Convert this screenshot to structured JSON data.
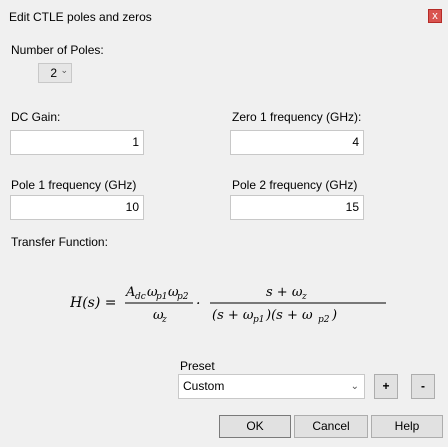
{
  "window": {
    "title": "Edit CTLE poles and zeros",
    "close_label": "x"
  },
  "poles": {
    "label": "Number of Poles:",
    "value": "2"
  },
  "dc_gain": {
    "label": "DC Gain:",
    "value": "1"
  },
  "zero1": {
    "label": "Zero 1 frequency (GHz):",
    "value": "4"
  },
  "pole1": {
    "label": "Pole 1 frequency (GHz)",
    "value": "10"
  },
  "pole2": {
    "label": "Pole 2 frequency (GHz)",
    "value": "15"
  },
  "transfer": {
    "label": "Transfer Function:"
  },
  "preset": {
    "label": "Preset",
    "value": "Custom",
    "add_label": "+",
    "remove_label": "-"
  },
  "buttons": {
    "ok": "OK",
    "cancel": "Cancel",
    "help": "Help"
  },
  "icons": {
    "close": "close-icon",
    "dropdown": "chevron-down-icon"
  },
  "colors": {
    "close_bg": "#d9534f",
    "window_bg": "#f0f0f0"
  }
}
